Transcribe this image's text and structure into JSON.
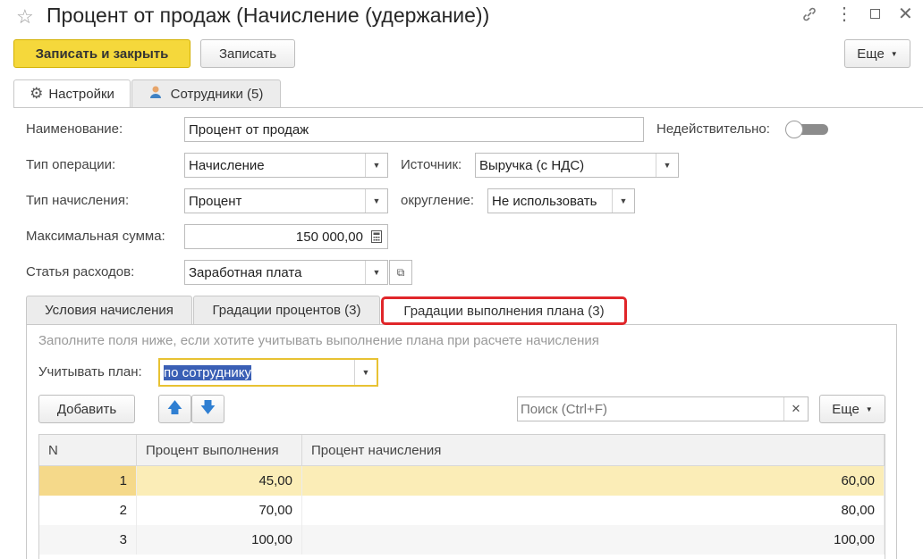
{
  "window": {
    "title": "Процент от продаж (Начисление (удержание))",
    "icons": [
      "star-icon",
      "link-icon",
      "more-icon",
      "maximize-icon",
      "close-icon"
    ]
  },
  "toolbar": {
    "save_close_label": "Записать и закрыть",
    "save_label": "Записать",
    "more_label": "Еще"
  },
  "tabs": {
    "settings": "Настройки",
    "employees": "Сотрудники (5)"
  },
  "form": {
    "name_label": "Наименование:",
    "name_value": "Процент от продаж",
    "invalid_label": "Недействительно:",
    "invalid_on": false,
    "op_type_label": "Тип операции:",
    "op_type_value": "Начисление",
    "source_label": "Источник:",
    "source_value": "Выручка (с НДС)",
    "charge_type_label": "Тип начисления:",
    "charge_type_value": "Процент",
    "rounding_label": "округление:",
    "rounding_value": "Не использовать",
    "max_sum_label": "Максимальная сумма:",
    "max_sum_value": "150 000,00",
    "expense_label": "Статья расходов:",
    "expense_value": "Заработная плата"
  },
  "inner_tabs": {
    "conditions": "Условия начисления",
    "percent_grades": "Градации процентов (3)",
    "plan_grades": "Градации выполнения плана (3)"
  },
  "plan": {
    "hint": "Заполните поля ниже, если хотите учитывать выполнение плана при расчете начисления",
    "consider_label": "Учитывать план:",
    "consider_value": "по сотруднику",
    "add_label": "Добавить",
    "search_placeholder": "Поиск (Ctrl+F)",
    "more_label": "Еще"
  },
  "table": {
    "columns": [
      "N",
      "Процент выполнения",
      "Процент начисления"
    ],
    "rows": [
      {
        "n": "1",
        "completion": "45,00",
        "accrual": "60,00"
      },
      {
        "n": "2",
        "completion": "70,00",
        "accrual": "80,00"
      },
      {
        "n": "3",
        "completion": "100,00",
        "accrual": "100,00"
      }
    ]
  },
  "colors": {
    "primary_button": "#f5d83b",
    "highlight_border": "#e0262a",
    "focus_border": "#e8c233",
    "selected_row": "#fbedb7"
  }
}
